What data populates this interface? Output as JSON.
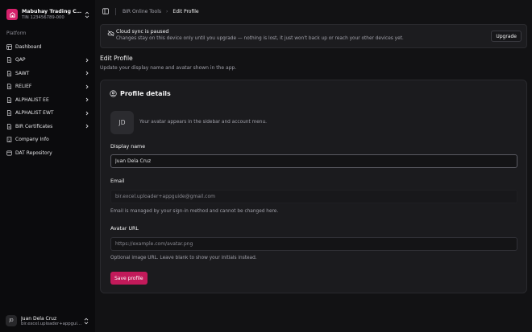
{
  "org": {
    "name": "Mabuhay Trading Corp...",
    "tin": "TIN 123456789-000"
  },
  "sidebar": {
    "section_label": "Platform",
    "items": [
      {
        "label": "Dashboard",
        "icon": "dashboard-icon",
        "has_chevron": false
      },
      {
        "label": "QAP",
        "icon": "document-icon",
        "has_chevron": true
      },
      {
        "label": "SAWT",
        "icon": "document-icon",
        "has_chevron": true
      },
      {
        "label": "RELIEF",
        "icon": "document-icon",
        "has_chevron": true
      },
      {
        "label": "ALPHALIST EE",
        "icon": "document-icon",
        "has_chevron": true
      },
      {
        "label": "ALPHALIST EWT",
        "icon": "document-icon",
        "has_chevron": true
      },
      {
        "label": "BIR Certificates",
        "icon": "document-icon",
        "has_chevron": true
      },
      {
        "label": "Company Info",
        "icon": "building-icon",
        "has_chevron": false
      },
      {
        "label": "DAT Repository",
        "icon": "database-icon",
        "has_chevron": false
      }
    ]
  },
  "user": {
    "initials": "JD",
    "name": "Juan Dela Cruz",
    "email": "bir.excel.uploader+appguid..."
  },
  "breadcrumb": {
    "parent": "BIR Online Tools",
    "separator": "›",
    "current": "Edit Profile"
  },
  "banner": {
    "title": "Cloud sync is paused",
    "description": "Changes stay on this device only until you upgrade — nothing is lost, it just won't back up or reach your other devices yet.",
    "button": "Upgrade"
  },
  "page": {
    "title": "Edit Profile",
    "subtitle": "Update your display name and avatar shown in the app."
  },
  "profile": {
    "title": "Profile details",
    "avatar_initials": "JD",
    "avatar_note": "Your avatar appears in the sidebar and account menu.",
    "display_name_label": "Display name",
    "display_name_value": "Juan Dela Cruz",
    "email_label": "Email",
    "email_value": "bir.excel.uploader+appguide@gmail.com",
    "email_hint": "Email is managed by your sign-in method and cannot be changed here.",
    "avatar_url_label": "Avatar URL",
    "avatar_url_placeholder": "https://example.com/avatar.png",
    "avatar_url_hint": "Optional image URL. Leave blank to show your initials instead.",
    "save_button": "Save profile"
  },
  "colors": {
    "accent": "#c21a5a",
    "brand_logo": "#d6216b",
    "background": "#121214",
    "card": "#1b1b1e"
  }
}
